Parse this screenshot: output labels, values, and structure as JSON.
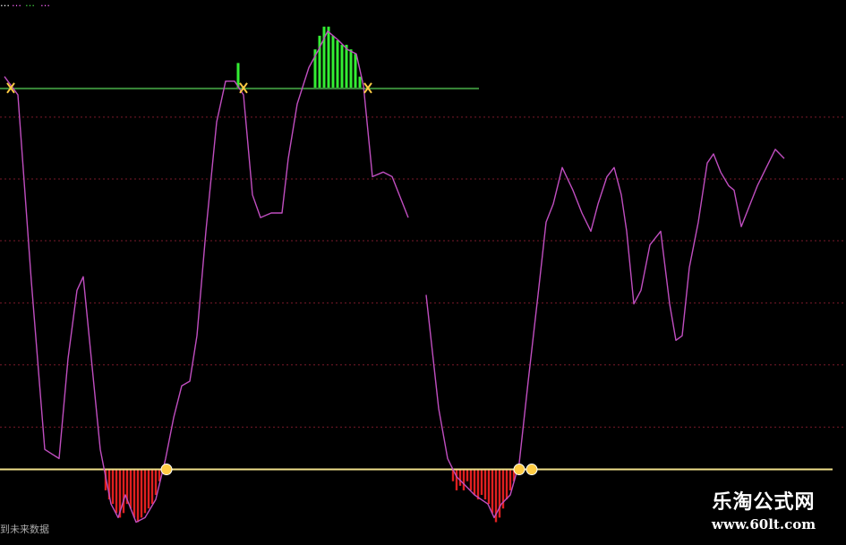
{
  "header": {
    "t1": "…",
    "t2": "…",
    "t3": "…",
    "t4": "…"
  },
  "footer_note": "到未来数据",
  "watermark": {
    "title": "乐淘公式网",
    "url": "www.60lt.com"
  },
  "colors": {
    "background": "#000000",
    "oscillator": "#c04ec0",
    "upper_line": "#3a8a3a",
    "lower_line": "#f0e08a",
    "grid": "#7a1a2a",
    "green_bars": "#33ee33",
    "red_bars": "#e02020",
    "marker": "#ffcc44"
  },
  "chart_data": {
    "type": "line",
    "title": "",
    "xlabel": "",
    "ylabel": "",
    "xlim": [
      0,
      945
    ],
    "ylim": [
      0,
      100
    ],
    "grid": true,
    "grid_levels": [
      14.9,
      28.6,
      42.2,
      55.9,
      69.5,
      83.1
    ],
    "upper_threshold": 89.4,
    "lower_threshold": 5.6,
    "upper_threshold_extent": [
      0,
      535
    ],
    "lower_threshold_extent": [
      0,
      930
    ],
    "series": [
      {
        "segments": [
          [
            [
              5,
              92
            ],
            [
              20,
              88
            ],
            [
              35,
              47
            ],
            [
              50,
              10
            ],
            [
              58,
              9
            ],
            [
              66,
              8
            ],
            [
              76,
              30
            ],
            [
              86,
              45
            ],
            [
              93,
              48
            ],
            [
              102,
              30
            ],
            [
              112,
              10
            ],
            [
              124,
              -2
            ],
            [
              132,
              -5
            ],
            [
              140,
              0
            ],
            [
              152,
              -6
            ],
            [
              162,
              -5
            ],
            [
              174,
              -1
            ],
            [
              185,
              8
            ],
            [
              194,
              17
            ],
            [
              203,
              24
            ],
            [
              212,
              25
            ],
            [
              220,
              35
            ],
            [
              230,
              58
            ],
            [
              242,
              82
            ],
            [
              252,
              91
            ],
            [
              262,
              91
            ],
            [
              272,
              88
            ],
            [
              282,
              66
            ],
            [
              291,
              61
            ],
            [
              303,
              62
            ],
            [
              315,
              62
            ],
            [
              322,
              74
            ],
            [
              332,
              86
            ],
            [
              345,
              94
            ],
            [
              356,
              98
            ],
            [
              366,
              102
            ],
            [
              378,
              100
            ],
            [
              388,
              98
            ],
            [
              398,
              97
            ],
            [
              406,
              90
            ],
            [
              416,
              70
            ],
            [
              428,
              71
            ],
            [
              438,
              70
            ],
            [
              456,
              61
            ]
          ],
          [
            [
              476,
              44
            ],
            [
              490,
              19
            ],
            [
              500,
              8
            ],
            [
              510,
              4
            ],
            [
              520,
              2
            ],
            [
              530,
              0
            ],
            [
              545,
              -2
            ],
            [
              552,
              -5
            ],
            [
              560,
              -2
            ],
            [
              570,
              0
            ],
            [
              580,
              7
            ],
            [
              590,
              25
            ],
            [
              601,
              44
            ]
          ],
          [
            [
              601,
              44
            ],
            [
              610,
              60
            ],
            [
              618,
              64
            ],
            [
              628,
              72
            ],
            [
              640,
              67
            ],
            [
              650,
              62
            ],
            [
              660,
              58
            ],
            [
              668,
              64
            ],
            [
              678,
              70
            ],
            [
              686,
              72
            ],
            [
              694,
              66
            ],
            [
              700,
              58
            ],
            [
              708,
              42
            ],
            [
              716,
              45
            ],
            [
              726,
              55
            ],
            [
              738,
              58
            ],
            [
              748,
              42
            ],
            [
              755,
              34
            ],
            [
              762,
              35
            ],
            [
              770,
              50
            ],
            [
              780,
              60
            ],
            [
              790,
              73
            ],
            [
              797,
              75
            ],
            [
              805,
              71
            ],
            [
              814,
              68
            ],
            [
              820,
              67
            ],
            [
              828,
              59
            ],
            [
              836,
              63
            ],
            [
              846,
              68
            ],
            [
              856,
              72
            ],
            [
              866,
              76
            ],
            [
              876,
              74
            ]
          ]
        ]
      }
    ],
    "green_bars": [
      {
        "x": 266,
        "top": 95
      },
      {
        "x": 352,
        "top": 98
      },
      {
        "x": 357,
        "top": 101
      },
      {
        "x": 362,
        "top": 103
      },
      {
        "x": 367,
        "top": 103
      },
      {
        "x": 372,
        "top": 101
      },
      {
        "x": 377,
        "top": 100
      },
      {
        "x": 382,
        "top": 99
      },
      {
        "x": 387,
        "top": 99
      },
      {
        "x": 392,
        "top": 98
      },
      {
        "x": 397,
        "top": 97
      },
      {
        "x": 402,
        "top": 92
      }
    ],
    "red_bars": [
      {
        "x": 118,
        "bottom": 1
      },
      {
        "x": 122,
        "bottom": -1
      },
      {
        "x": 126,
        "bottom": -2
      },
      {
        "x": 130,
        "bottom": -4
      },
      {
        "x": 134,
        "bottom": -5
      },
      {
        "x": 138,
        "bottom": -4
      },
      {
        "x": 142,
        "bottom": -2
      },
      {
        "x": 146,
        "bottom": -3
      },
      {
        "x": 150,
        "bottom": -5
      },
      {
        "x": 154,
        "bottom": -6
      },
      {
        "x": 158,
        "bottom": -5
      },
      {
        "x": 162,
        "bottom": -4
      },
      {
        "x": 166,
        "bottom": -3
      },
      {
        "x": 170,
        "bottom": -2
      },
      {
        "x": 174,
        "bottom": 0
      },
      {
        "x": 178,
        "bottom": 3
      },
      {
        "x": 506,
        "bottom": 3
      },
      {
        "x": 510,
        "bottom": 1
      },
      {
        "x": 514,
        "bottom": 2
      },
      {
        "x": 518,
        "bottom": 1
      },
      {
        "x": 522,
        "bottom": 3
      },
      {
        "x": 526,
        "bottom": 1
      },
      {
        "x": 530,
        "bottom": 0
      },
      {
        "x": 534,
        "bottom": -1
      },
      {
        "x": 538,
        "bottom": 0
      },
      {
        "x": 542,
        "bottom": -1
      },
      {
        "x": 546,
        "bottom": -2
      },
      {
        "x": 550,
        "bottom": -4
      },
      {
        "x": 554,
        "bottom": -6
      },
      {
        "x": 558,
        "bottom": -5
      },
      {
        "x": 562,
        "bottom": -3
      },
      {
        "x": 566,
        "bottom": -1
      },
      {
        "x": 570,
        "bottom": 1
      },
      {
        "x": 574,
        "bottom": 3
      }
    ],
    "sell_signals": [
      {
        "x": 12,
        "y": 89.4
      },
      {
        "x": 272,
        "y": 89.4
      },
      {
        "x": 411,
        "y": 89.4
      }
    ],
    "buy_signals": [
      {
        "x": 186,
        "y": 5.6
      },
      {
        "x": 580,
        "y": 5.6
      },
      {
        "x": 594,
        "y": 5.6
      }
    ]
  }
}
